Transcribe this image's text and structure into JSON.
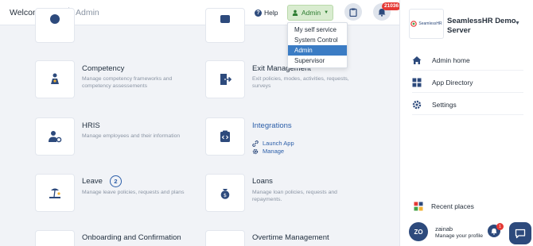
{
  "header": {
    "welcome": "Welcome zainab",
    "breadcrumb": "Admin",
    "help_label": "Help",
    "admin_label": "Admin",
    "notification_count": "21036"
  },
  "role_menu": {
    "items": [
      "My self service",
      "System Control",
      "Admin",
      "Supervisor"
    ],
    "active": "Admin"
  },
  "modules": {
    "competency": {
      "title": "Competency",
      "description": "Manage competency frameworks and competency assessements"
    },
    "exit": {
      "title": "Exit Management",
      "description": "Exit policies, modes, activities, requests, surveys"
    },
    "hris": {
      "title": "HRIS",
      "description": "Manage employees and their information"
    },
    "integrations": {
      "title": "Integrations",
      "launch": "Launch App",
      "manage": "Manage"
    },
    "leave": {
      "title": "Leave",
      "badge": "2",
      "description": "Manage leave policies, requests and plans"
    },
    "loans": {
      "title": "Loans",
      "description": "Manage loan policies, requests and repayments."
    },
    "onboarding": {
      "title": "Onboarding and Confirmation"
    },
    "overtime": {
      "title": "Overtime Management"
    }
  },
  "panel": {
    "logo_text": "SeamlessHR",
    "server_name": "SeamlessHR Demo Server",
    "nav": [
      {
        "label": "Admin home",
        "icon": "home-icon"
      },
      {
        "label": "App Directory",
        "icon": "grid-icon"
      },
      {
        "label": "Settings",
        "icon": "gear-icon"
      }
    ],
    "recent_places": "Recent places",
    "user": {
      "initials": "ZO",
      "name": "zainab",
      "subtitle": "Manage your profile",
      "bell_count": "1"
    }
  },
  "colors": {
    "primary": "#2d4a7c",
    "link": "#2a5da8",
    "admin_green": "#d9ecd0",
    "badge_red": "#e53935"
  }
}
